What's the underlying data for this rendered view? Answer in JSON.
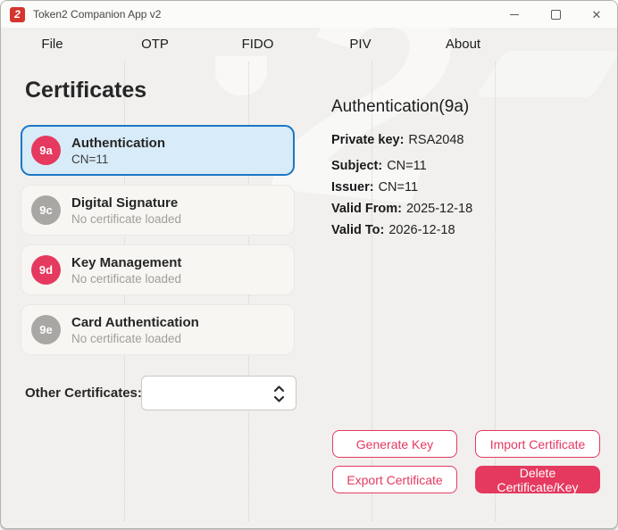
{
  "window": {
    "title": "Token2 Companion App v2",
    "icon_glyph": "2"
  },
  "menu": {
    "items": [
      {
        "label": "File"
      },
      {
        "label": "OTP"
      },
      {
        "label": "FIDO"
      },
      {
        "label": "PIV"
      },
      {
        "label": "About"
      }
    ]
  },
  "certificates": {
    "heading": "Certificates",
    "slots": [
      {
        "badge": "9a",
        "title": "Authentication",
        "subtitle": "CN=11",
        "selected": true
      },
      {
        "badge": "9c",
        "title": "Digital Signature",
        "subtitle": "No certificate loaded",
        "selected": false
      },
      {
        "badge": "9d",
        "title": "Key Management",
        "subtitle": "No certificate loaded",
        "selected": false
      },
      {
        "badge": "9e",
        "title": "Card Authentication",
        "subtitle": "No certificate loaded",
        "selected": false
      }
    ],
    "other_certificates_label": "Other Certificates:",
    "other_certificates_value": ""
  },
  "details": {
    "heading": "Authentication(9a)",
    "fields": [
      {
        "label": "Private key:",
        "value": "RSA2048"
      },
      {
        "label": "Subject:",
        "value": "CN=11"
      },
      {
        "label": "Issuer:",
        "value": "CN=11"
      },
      {
        "label": "Valid From:",
        "value": "2025-12-18"
      },
      {
        "label": "Valid To:",
        "value": "2026-12-18"
      }
    ]
  },
  "actions": {
    "generate_key": "Generate Key",
    "import_certificate": "Import Certificate",
    "export_certificate": "Export Certificate",
    "delete_certificate": "Delete Certificate/Key"
  },
  "colors": {
    "accent_pink": "#e5395f",
    "badge_gray": "#a9a7a4",
    "selected_bg": "#d7ebf8",
    "selected_border": "#1d77c4",
    "app_icon_red": "#d6352f",
    "window_bg": "#f1f0ee"
  }
}
